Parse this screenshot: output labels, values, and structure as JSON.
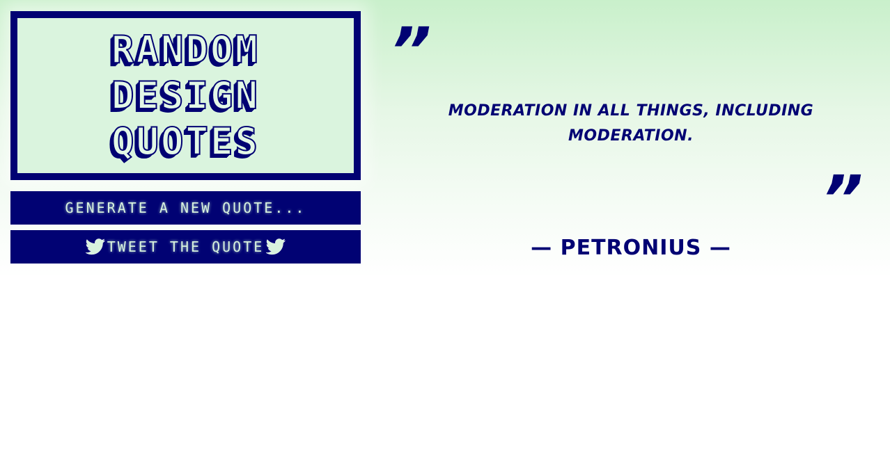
{
  "title": {
    "line1": "Random",
    "line2": "Design",
    "line3": "Quotes"
  },
  "buttons": {
    "generate_label": "Generate a new quote...",
    "tweet_label": "Tweet the quote"
  },
  "quote": {
    "open_mark": "”",
    "close_mark": "”",
    "text": "Moderation in all things, including moderation.",
    "author": "— Petronius —"
  },
  "icons": {
    "tweet_left": "twitter-bird-icon",
    "tweet_right": "twitter-bird-icon"
  },
  "colors": {
    "primary": "#010273",
    "background_top": "#c9f0cb",
    "background_bottom": "#ffffff",
    "title_fill": "#e3f8e6"
  }
}
